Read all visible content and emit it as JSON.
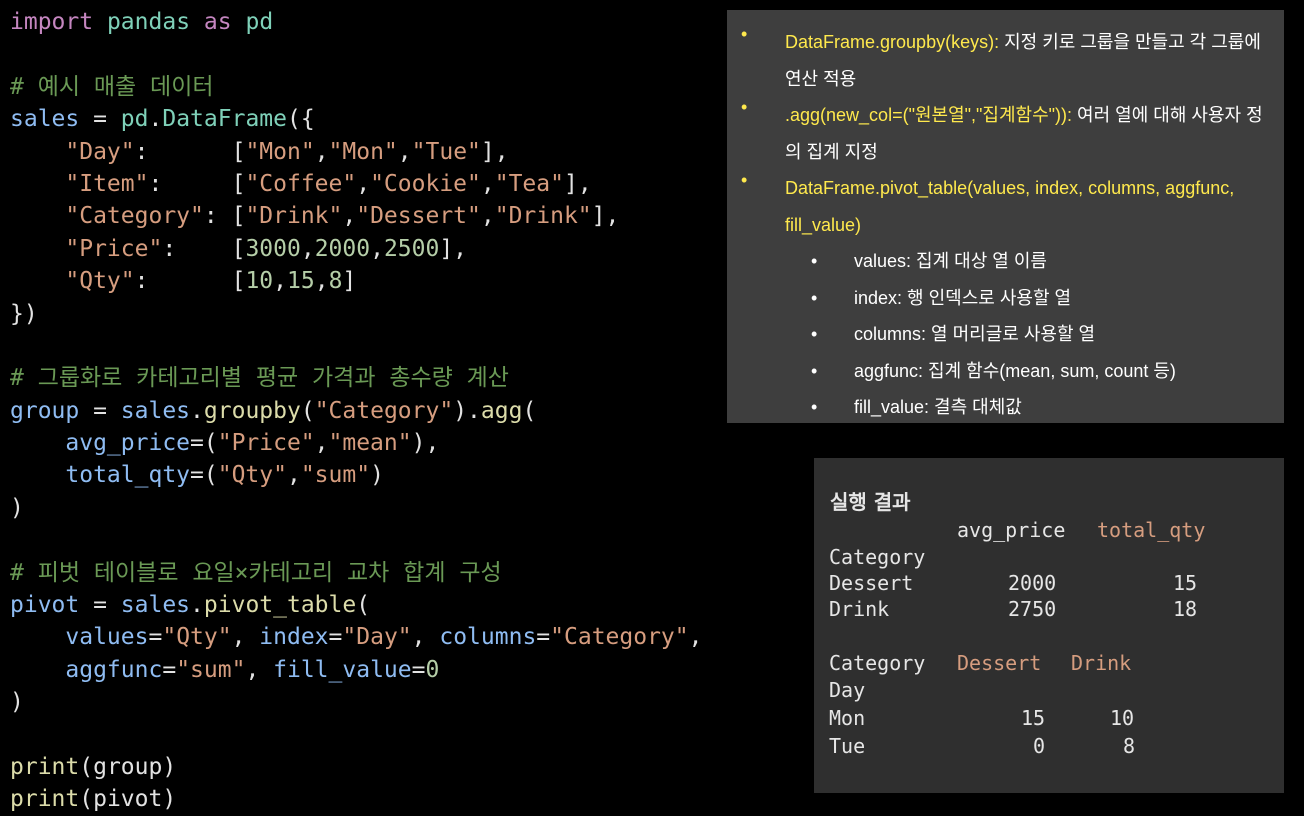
{
  "code": {
    "l1": {
      "a": "import",
      "b": " ",
      "c": "pandas",
      "d": " ",
      "e": "as",
      "f": " ",
      "g": "pd"
    },
    "comment1": "# 예시 매출 데이터",
    "l3": {
      "a": "sales",
      "b": " = ",
      "c": "pd",
      "d": ".",
      "e": "DataFrame",
      "f": "({"
    },
    "l4": {
      "a": "    ",
      "b": "\"Day\"",
      "c": ":      ",
      "d": "[",
      "e": "\"Mon\"",
      "f": ",",
      "g": "\"Mon\"",
      "h": ",",
      "i": "\"Tue\"",
      "j": "],"
    },
    "l5": {
      "a": "    ",
      "b": "\"Item\"",
      "c": ":     ",
      "d": "[",
      "e": "\"Coffee\"",
      "f": ",",
      "g": "\"Cookie\"",
      "h": ",",
      "i": "\"Tea\"",
      "j": "],"
    },
    "l6": {
      "a": "    ",
      "b": "\"Category\"",
      "c": ": ",
      "d": "[",
      "e": "\"Drink\"",
      "f": ",",
      "g": "\"Dessert\"",
      "h": ",",
      "i": "\"Drink\"",
      "j": "],"
    },
    "l7": {
      "a": "    ",
      "b": "\"Price\"",
      "c": ":    ",
      "d": "[",
      "e": "3000",
      "f": ",",
      "g": "2000",
      "h": ",",
      "i": "2500",
      "j": "],"
    },
    "l8": {
      "a": "    ",
      "b": "\"Qty\"",
      "c": ":      ",
      "d": "[",
      "e": "10",
      "f": ",",
      "g": "15",
      "h": ",",
      "i": "8",
      "j": "]"
    },
    "l9": "})",
    "comment2": "# 그룹화로 카테고리별 평균 가격과 총수량 계산",
    "l12": {
      "a": "group",
      "b": " = ",
      "c": "sales",
      "d": ".",
      "e": "groupby",
      "f": "(",
      "g": "\"Category\"",
      "h": ").",
      "i": "agg",
      "j": "("
    },
    "l13": {
      "a": "    ",
      "b": "avg_price",
      "c": "=(",
      "d": "\"Price\"",
      "e": ",",
      "f": "\"mean\"",
      "g": "),"
    },
    "l14": {
      "a": "    ",
      "b": "total_qty",
      "c": "=(",
      "d": "\"Qty\"",
      "e": ",",
      "f": "\"sum\"",
      "g": ")"
    },
    "l15": ")",
    "comment3": "# 피벗 테이블로 요일×카테고리 교차 합계 구성",
    "l18": {
      "a": "pivot",
      "b": " = ",
      "c": "sales",
      "d": ".",
      "e": "pivot_table",
      "f": "("
    },
    "l19": {
      "a": "    ",
      "b": "values",
      "c": "=",
      "d": "\"Qty\"",
      "e": ", ",
      "f": "index",
      "g": "=",
      "h": "\"Day\"",
      "i": ", ",
      "j": "columns",
      "k": "=",
      "l": "\"Category\"",
      "m": ","
    },
    "l20": {
      "a": "    ",
      "b": "aggfunc",
      "c": "=",
      "d": "\"sum\"",
      "e": ", ",
      "f": "fill_value",
      "g": "=",
      "h": "0"
    },
    "l21": ")",
    "l23": {
      "a": "print",
      "b": "(",
      "c": "group",
      "d": ")"
    },
    "l24": {
      "a": "print",
      "b": "(",
      "c": "pivot",
      "d": ")"
    }
  },
  "notes": {
    "bullet": "•",
    "n1_name": "DataFrame.groupby(keys):",
    "n1_desc": " 지정 키로 그룹을 만들고 각 그룹에 연산 적용",
    "n2_name": ".agg(new_col=(\"원본열\",\"집계함수\")):",
    "n2_desc": " 여러 열에 대해 사용자 정의 집계 지정",
    "n3_name": "DataFrame.pivot_table(values, index, columns, aggfunc, fill_value)",
    "sub": [
      "values: 집계 대상 열 이름",
      "index: 행 인덱스로 사용할 열",
      "columns: 열 머리글로 사용할 열",
      "aggfunc: 집계 함수(mean, sum, count 등)",
      "fill_value: 결측 대체값"
    ]
  },
  "result": {
    "title": "실행 결과",
    "g_col1": "avg_price",
    "g_col2": "total_qty",
    "g_index": "Category",
    "g_rows": [
      {
        "label": "Dessert",
        "avg": "2000",
        "qty": "15"
      },
      {
        "label": "Drink",
        "avg": "2750",
        "qty": "18"
      }
    ],
    "p_colname": "Category",
    "p_col1": "Dessert",
    "p_col2": "Drink",
    "p_index": "Day",
    "p_rows": [
      {
        "label": "Mon",
        "dessert": "15",
        "drink": "10"
      },
      {
        "label": "Tue",
        "dessert": "0",
        "drink": "8"
      }
    ]
  }
}
